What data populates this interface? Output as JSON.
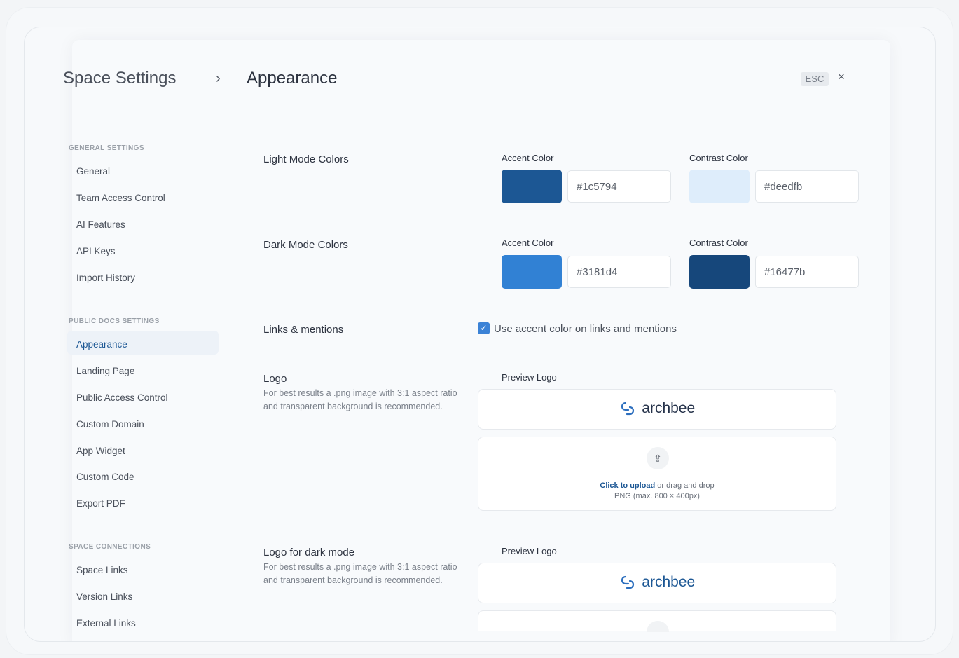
{
  "header": {
    "title": "Space Settings",
    "separator": "›",
    "page": "Appearance",
    "esc_label": "ESC",
    "close_glyph": "×"
  },
  "sidebar": {
    "general_heading": "GENERAL SETTINGS",
    "general_items": [
      "General",
      "Team Access Control",
      "AI Features",
      "API Keys",
      "Import History"
    ],
    "public_heading": "PUBLIC DOCS SETTINGS",
    "public_items": [
      "Appearance",
      "Landing Page",
      "Public Access Control",
      "Custom Domain",
      "App Widget",
      "Custom Code",
      "Export PDF"
    ],
    "connections_heading": "SPACE CONNECTIONS",
    "connections_items": [
      "Space Links",
      "Version Links",
      "External Links"
    ],
    "active_item": "Appearance"
  },
  "light_mode": {
    "title": "Light Mode Colors",
    "accent_label": "Accent Color",
    "accent_value": "#1c5794",
    "contrast_label": "Contrast Color",
    "contrast_value": "#deedfb"
  },
  "dark_mode": {
    "title": "Dark Mode Colors",
    "accent_label": "Accent Color",
    "accent_value": "#3181d4",
    "contrast_label": "Contrast Color",
    "contrast_value": "#16477b"
  },
  "links": {
    "title": "Links & mentions",
    "checkbox_label": "Use accent color on links and mentions",
    "checked": true
  },
  "logo": {
    "title": "Logo",
    "description": "For best results a .png image with 3:1 aspect ratio and transparent background is recommended.",
    "preview_label": "Preview Logo",
    "brand_word": "archbee",
    "upload_link": "Click to upload",
    "upload_rest": " or drag and drop",
    "upload_hint": "PNG (max. 800 × 400px)"
  },
  "logo_dark": {
    "title": "Logo for dark mode",
    "description": "For best results a .png image with 3:1 aspect ratio and transparent background is recommended.",
    "preview_label": "Preview Logo",
    "brand_word": "archbee"
  },
  "colors": {
    "accent": "#1c5794",
    "checkbox": "#3b82d6"
  },
  "icons": [
    "chevron-right-icon",
    "close-icon",
    "check-icon",
    "upload-cloud-icon",
    "archbee-logo-icon"
  ]
}
